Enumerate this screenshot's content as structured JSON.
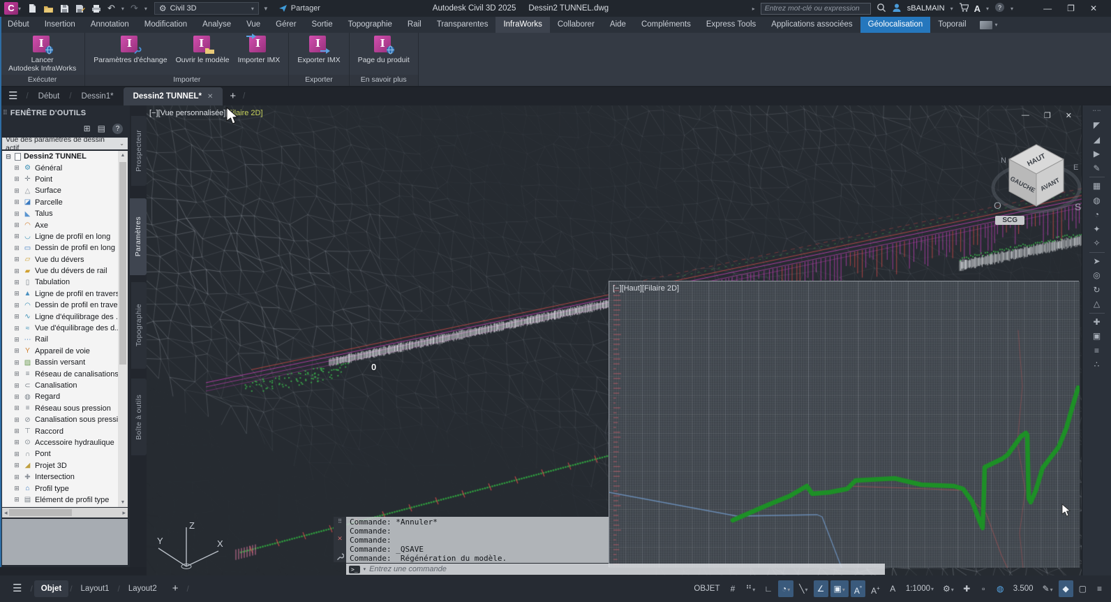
{
  "titlebar": {
    "app_logo": "C",
    "workspace": "Civil 3D",
    "share_label": "Partager",
    "app_title": "Autodesk Civil 3D 2025",
    "doc_title": "Dessin2 TUNNEL.dwg",
    "search_placeholder": "Entrez mot-clé ou expression",
    "user_name": "sBALMAIN",
    "appstore_glyph": "A",
    "help_glyph": "?",
    "win_min": "—",
    "win_max": "❐",
    "win_close": "✕"
  },
  "ribbon": {
    "tabs": [
      {
        "label": "Début"
      },
      {
        "label": "Insertion"
      },
      {
        "label": "Annotation"
      },
      {
        "label": "Modification"
      },
      {
        "label": "Analyse"
      },
      {
        "label": "Vue"
      },
      {
        "label": "Gérer"
      },
      {
        "label": "Sortie"
      },
      {
        "label": "Topographie"
      },
      {
        "label": "Rail"
      },
      {
        "label": "Transparentes"
      },
      {
        "label": "InfraWorks",
        "active": true
      },
      {
        "label": "Collaborer"
      },
      {
        "label": "Aide"
      },
      {
        "label": "Compléments"
      },
      {
        "label": "Express Tools"
      },
      {
        "label": "Applications associées"
      },
      {
        "label": "Géolocalisation",
        "accent": true
      },
      {
        "label": "Toporail"
      }
    ],
    "groups": [
      {
        "title": "Exécuter",
        "buttons": [
          {
            "name": "launch-infraworks-button",
            "icon": "globe",
            "lines": [
              "Lancer",
              "Autodesk InfraWorks"
            ]
          }
        ]
      },
      {
        "title": "Importer",
        "buttons": [
          {
            "name": "exchange-settings-button",
            "icon": "wrench",
            "lines": [
              "Paramètres d'échange"
            ]
          },
          {
            "name": "open-model-button",
            "icon": "folder",
            "lines": [
              "Ouvrir le modèle"
            ]
          },
          {
            "name": "import-imx-button",
            "icon": "arrow-in",
            "lines": [
              "Importer IMX"
            ]
          }
        ]
      },
      {
        "title": "Exporter",
        "buttons": [
          {
            "name": "export-imx-button",
            "icon": "arrow-out",
            "lines": [
              "Exporter IMX"
            ]
          }
        ]
      },
      {
        "title": "En savoir plus",
        "buttons": [
          {
            "name": "product-page-button",
            "icon": "globe",
            "lines": [
              "Page du produit"
            ]
          }
        ]
      }
    ],
    "cube_letter": "I"
  },
  "doc_tabs": {
    "items": [
      {
        "label": "Début"
      },
      {
        "label": "Dessin1*"
      },
      {
        "label": "Dessin2 TUNNEL*",
        "active": true,
        "closable": true
      }
    ],
    "close_glyph": "✕",
    "add_glyph": "+"
  },
  "palette": {
    "title": "FENÊTRE D'OUTILS",
    "toolbar_icons": [
      {
        "name": "palette-display-icon",
        "g": "⊞"
      },
      {
        "name": "edit-drawing-settings-icon",
        "g": "▤"
      }
    ],
    "help_glyph": "?",
    "view_selector": "Vue des paramètres de dessin actif",
    "root_label": "Dessin2 TUNNEL",
    "items": [
      {
        "label": "Général",
        "g": "⚙",
        "c": "#3a8fb5"
      },
      {
        "label": "Point",
        "g": "✛",
        "c": "#7a828a"
      },
      {
        "label": "Surface",
        "g": "△",
        "c": "#8a9098"
      },
      {
        "label": "Parcelle",
        "g": "◪",
        "c": "#3a7ac0"
      },
      {
        "label": "Talus",
        "g": "◣",
        "c": "#5a95d0"
      },
      {
        "label": "Axe",
        "g": "◠",
        "c": "#d08030"
      },
      {
        "label": "Ligne de profil en long",
        "g": "◡",
        "c": "#3a8fb5"
      },
      {
        "label": "Dessin de profil en long",
        "g": "▭",
        "c": "#3a7ac0"
      },
      {
        "label": "Vue du dévers",
        "g": "▱",
        "c": "#d0a030"
      },
      {
        "label": "Vue du dévers de rail",
        "g": "▰",
        "c": "#d0a030"
      },
      {
        "label": "Tabulation",
        "g": "▯",
        "c": "#7a828a"
      },
      {
        "label": "Ligne de profil en travers",
        "g": "▲",
        "c": "#4a90c0"
      },
      {
        "label": "Dessin de profil en travers",
        "g": "◠",
        "c": "#3a8fb5"
      },
      {
        "label": "Ligne d'équilibrage des ...",
        "g": "∿",
        "c": "#3a8fb5"
      },
      {
        "label": "Vue d'équilibrage des d...",
        "g": "≈",
        "c": "#3a8fb5"
      },
      {
        "label": "Rail",
        "g": "⋯",
        "c": "#3a7ac0"
      },
      {
        "label": "Appareil de voie",
        "g": "Y",
        "c": "#d08030"
      },
      {
        "label": "Bassin versant",
        "g": "▨",
        "c": "#6a9a50"
      },
      {
        "label": "Réseau de canalisations",
        "g": "≡",
        "c": "#7a828a"
      },
      {
        "label": "Canalisation",
        "g": "⊂",
        "c": "#7a828a"
      },
      {
        "label": "Regard",
        "g": "◍",
        "c": "#7a828a"
      },
      {
        "label": "Réseau sous pression",
        "g": "≡",
        "c": "#7a828a"
      },
      {
        "label": "Canalisation sous pressi...",
        "g": "⊘",
        "c": "#7a828a"
      },
      {
        "label": "Raccord",
        "g": "⊤",
        "c": "#7a828a"
      },
      {
        "label": "Accessoire hydraulique",
        "g": "⊙",
        "c": "#7a828a"
      },
      {
        "label": "Pont",
        "g": "∩",
        "c": "#7a828a"
      },
      {
        "label": "Projet 3D",
        "g": "◢",
        "c": "#c0a040"
      },
      {
        "label": "Intersection",
        "g": "✚",
        "c": "#8a9098"
      },
      {
        "label": "Profil type",
        "g": "⌂",
        "c": "#3a7ac0"
      },
      {
        "label": "Elément de profil type",
        "g": "▤",
        "c": "#7a828a"
      }
    ],
    "side_tabs": [
      {
        "label": "Prospecteur"
      },
      {
        "label": "Paramètres",
        "active": true
      },
      {
        "label": "Topographie"
      },
      {
        "label": "Boîte à outils"
      }
    ]
  },
  "viewport": {
    "main_label_prefix": "[−][Vue personnalisée][",
    "main_label_style": "Filaire 2D",
    "main_label_suffix": "]",
    "overlay_label": "[−][Haut][Filaire 2D]",
    "controls": {
      "min": "—",
      "max": "❐",
      "close": "✕"
    },
    "viewcube": {
      "top": "HAUT",
      "left": "GAUCHE",
      "front": "AVANT",
      "compass": [
        "N",
        "E",
        "S",
        "O"
      ]
    },
    "ucs_label": "SCG",
    "axes": [
      "Y",
      "Z",
      "X"
    ],
    "station_label": "0"
  },
  "command": {
    "history": [
      "Commande: *Annuler*",
      "Commande:",
      "Commande:",
      "Commande: _QSAVE",
      "Commande:  Régénération du modèle."
    ],
    "input_icon": ">_",
    "input_placeholder": "Entrez une commande"
  },
  "nav": {
    "icons": [
      "◤",
      "◢",
      "▶",
      "✎",
      "▦",
      "◍",
      "◔",
      "✦",
      "✧",
      "➤",
      "◎",
      "↻",
      "△",
      "✚",
      "▣",
      "≡",
      "∴"
    ]
  },
  "statusbar": {
    "layout_tabs": [
      {
        "label": "Objet",
        "active": true
      },
      {
        "label": "Layout1"
      },
      {
        "label": "Layout2"
      }
    ],
    "add_glyph": "+",
    "items": [
      {
        "t": "label",
        "name": "model-space-button",
        "label": "OBJET"
      },
      {
        "t": "icon",
        "name": "grid-display-icon",
        "g": "#"
      },
      {
        "t": "icon",
        "name": "snap-mode-icon",
        "g": "⠛",
        "chev": true
      },
      {
        "t": "icon",
        "name": "ortho-mode-icon",
        "g": "∟"
      },
      {
        "t": "icon",
        "name": "polar-tracking-icon",
        "g": "◔",
        "chev": true,
        "active": true
      },
      {
        "t": "icon",
        "name": "isometric-drafting-icon",
        "g": "╲",
        "chev": true
      },
      {
        "t": "icon",
        "name": "osnap-tracking-icon",
        "g": "∠",
        "active": true
      },
      {
        "t": "icon",
        "name": "object-snap-icon",
        "g": "▣",
        "chev": true,
        "active": true
      },
      {
        "t": "icon",
        "name": "annotation-visibility-icon",
        "g": "A",
        "sub": "°",
        "active": true
      },
      {
        "t": "icon",
        "name": "annotation-autoscale-icon",
        "g": "A",
        "sub": "+"
      },
      {
        "t": "icon",
        "name": "annotation-scale-icon",
        "g": "A"
      },
      {
        "t": "label",
        "name": "annotation-scale-value",
        "label": "1:1000",
        "chev": true
      },
      {
        "t": "icon",
        "name": "workspace-gear-icon",
        "g": "⚙",
        "chev": true
      },
      {
        "t": "icon",
        "name": "annotation-monitor-icon",
        "g": "✚"
      },
      {
        "t": "icon",
        "name": "units-icon",
        "g": "▫"
      },
      {
        "t": "icon",
        "name": "geolocation-icon",
        "g": "◍",
        "blue": true
      },
      {
        "t": "label",
        "name": "elevation-display",
        "label": "3.500"
      },
      {
        "t": "icon",
        "name": "isolate-objects-icon",
        "g": "✎",
        "chev": true
      },
      {
        "t": "icon",
        "name": "quick-properties-icon",
        "g": "◆",
        "active": true
      },
      {
        "t": "icon",
        "name": "clean-screen-icon",
        "g": "▢"
      },
      {
        "t": "icon",
        "name": "customization-icon",
        "g": "≡"
      }
    ]
  },
  "colors": {
    "viewport_bg": "#262b31",
    "mesh_line": "#9ea4ad",
    "corridor_magenta": "#c33fb3",
    "corridor_red": "#d14a4a",
    "band_white": "#e6e9ec",
    "align_green": "#2f9e3f",
    "overlay_bg": "#3e444b",
    "profile_green": "#1d9026",
    "profile_blue": "#7096c6",
    "profile_red": "#c25555",
    "accent_blue": "#2577bd"
  }
}
